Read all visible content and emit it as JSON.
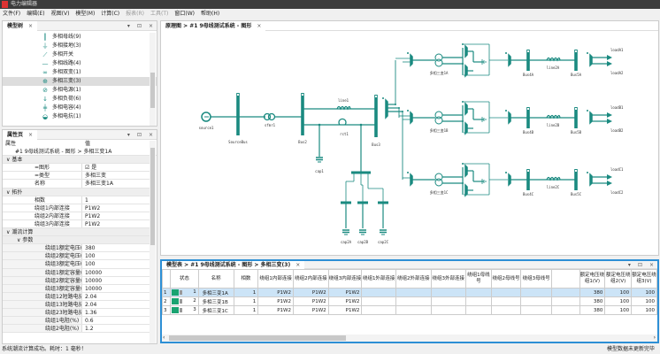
{
  "app": {
    "title": "电力编辑器"
  },
  "menu": [
    {
      "label": "文件(F)",
      "enabled": true
    },
    {
      "label": "编辑(E)",
      "enabled": true
    },
    {
      "label": "视图(V)",
      "enabled": true
    },
    {
      "label": "模型(M)",
      "enabled": true
    },
    {
      "label": "计算(C)",
      "enabled": true
    },
    {
      "label": "报表(R)",
      "enabled": false
    },
    {
      "label": "工具(T)",
      "enabled": false
    },
    {
      "label": "窗口(W)",
      "enabled": true
    },
    {
      "label": "帮助(H)",
      "enabled": true
    }
  ],
  "tree": {
    "tab": "模型树",
    "items": [
      {
        "label": "多相母线(9)",
        "icon": "busbar-icon"
      },
      {
        "label": "多相接地(3)",
        "icon": "ground-icon"
      },
      {
        "label": "多相开关",
        "icon": "switch-icon"
      },
      {
        "label": "多相线路(4)",
        "icon": "line-icon"
      },
      {
        "label": "多相双变(1)",
        "icon": "two-winding-transformer-icon"
      },
      {
        "label": "多相三变(3)",
        "icon": "three-winding-transformer-icon",
        "selected": true
      },
      {
        "label": "多相电源(1)",
        "icon": "source-icon"
      },
      {
        "label": "多相负荷(6)",
        "icon": "load-icon"
      },
      {
        "label": "多相电容(4)",
        "icon": "capacitor-icon"
      },
      {
        "label": "多相电抗(1)",
        "icon": "reactor-icon"
      }
    ]
  },
  "props": {
    "tab": "属性页",
    "col_key": "属性",
    "col_val": "值",
    "path": "#1 9母线测试系统 - 图形 > 多相三变1A",
    "rows": [
      {
        "group": "基本",
        "level": 0
      },
      {
        "k": "=图形",
        "v": "是",
        "checkbox": true,
        "level": 1
      },
      {
        "k": "=类型",
        "v": "多相三变",
        "level": 1
      },
      {
        "k": "名称",
        "v": "多相三变1A",
        "level": 1
      },
      {
        "group": "拓扑",
        "level": 0
      },
      {
        "k": "相数",
        "v": "1",
        "level": 1
      },
      {
        "k": "绕组1内部连接",
        "v": "P1W2",
        "level": 1
      },
      {
        "k": "绕组2内部连接",
        "v": "P1W2",
        "level": 1
      },
      {
        "k": "绕组3内部连接",
        "v": "P1W2",
        "level": 1
      },
      {
        "group": "潮流计算",
        "level": 0
      },
      {
        "group": "参数",
        "level": 1
      },
      {
        "k": "绕组1额定电压(V)",
        "v": "380",
        "level": 2
      },
      {
        "k": "绕组2额定电压(V)",
        "v": "100",
        "level": 2
      },
      {
        "k": "绕组3额定电压(V)",
        "v": "100",
        "level": 2
      },
      {
        "k": "绕组1额定容量(VA)",
        "v": "10000",
        "level": 2
      },
      {
        "k": "绕组2额定容量(VA)",
        "v": "10000",
        "level": 2
      },
      {
        "k": "绕组3额定容量(VA)",
        "v": "10000",
        "level": 2
      },
      {
        "k": "绕组12短路电抗(%)",
        "v": "2.04",
        "level": 2
      },
      {
        "k": "绕组13短路电抗(%)",
        "v": "2.04",
        "level": 2
      },
      {
        "k": "绕组23短路电抗(%)",
        "v": "1.36",
        "level": 2
      },
      {
        "k": "绕组1电阻(%)",
        "v": "0.6",
        "level": 2
      },
      {
        "k": "绕组2电阻(%)",
        "v": "1.2",
        "level": 2
      }
    ]
  },
  "diagram": {
    "tab": "原理图 > #1 9母线测试系统 - 图形",
    "accent": "#1a8a80",
    "labels": {
      "source1": "source1",
      "sourcebus": "SourceBus",
      "sfmr1": "sfmr1",
      "bus2": "Bus2",
      "line1": "line1",
      "rct1": "rct1",
      "bus3": "Bus3",
      "cap1": "cap1",
      "cap2a": "cap2A",
      "cap2b": "cap2B",
      "cap2c": "cap2C"
    },
    "branches": [
      {
        "xfmr": "多相三变1A",
        "bus4": "Bus4A",
        "line": "line2A",
        "bus5": "Bus5A",
        "load1": "loadA1",
        "load2": "loadA2"
      },
      {
        "xfmr": "多相三变1B",
        "bus4": "Bus4B",
        "line": "line2B",
        "bus5": "Bus5B",
        "load1": "loadB1",
        "load2": "loadB2"
      },
      {
        "xfmr": "多相三变1C",
        "bus4": "Bus4C",
        "line": "line2C",
        "bus5": "Bus5C",
        "load1": "loadC1",
        "load2": "loadC2"
      }
    ]
  },
  "table": {
    "tab": "模型表 > #1 9母线测试系统 - 图形 > 多相三变(3)",
    "columns": [
      "状态",
      "名称",
      "相数",
      "绕组1内部连接",
      "绕组2内部连接",
      "绕组3内部连接",
      "绕组1外部连接",
      "绕组2外部连接",
      "绕组3外部连接",
      "绕组1母线号",
      "绕组2母线号",
      "绕组3母线号",
      "",
      "额定电压绕组1(V)",
      "额定电压绕组2(V)",
      "额定电压绕组3(V)"
    ],
    "rows": [
      {
        "n": "1",
        "id": "1",
        "name": "多相三变1A",
        "phases": "1",
        "w1": "P1W2",
        "w2": "P1W2",
        "w3": "P1W2",
        "v1": "380",
        "v2": "100",
        "v3": "100",
        "selected": true
      },
      {
        "n": "2",
        "id": "2",
        "name": "多相三变1B",
        "phases": "1",
        "w1": "P1W2",
        "w2": "P1W2",
        "w3": "P1W2",
        "v1": "380",
        "v2": "100",
        "v3": "100"
      },
      {
        "n": "3",
        "id": "3",
        "name": "多相三变1C",
        "phases": "1",
        "w1": "P1W2",
        "w2": "P1W2",
        "w3": "P1W2",
        "v1": "380",
        "v2": "100",
        "v3": "100"
      }
    ]
  },
  "status": {
    "left": "系统潮流计算成功。耗时：1 毫秒！",
    "right": "模型数据未更新完毕"
  }
}
